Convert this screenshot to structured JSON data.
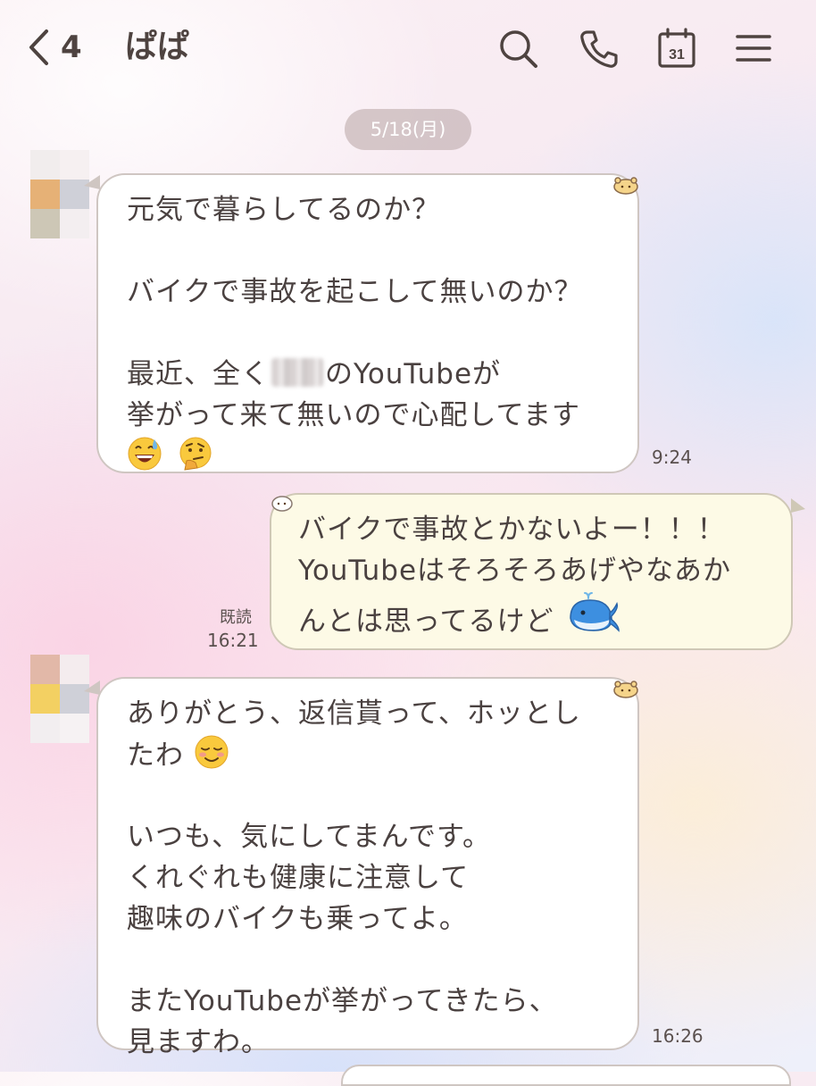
{
  "header": {
    "back_count": "4",
    "title": "ぱぱ",
    "calendar_day": "31"
  },
  "date_chip": "5/18(月)",
  "messages": [
    {
      "lines": [
        "元気で暮らしてるのか？",
        "",
        "バイクで事故を起こして無いのか？",
        "",
        "最近、全く",
        "のYouTubeが",
        "挙がって来て無いので心配してます"
      ],
      "time": "9:24"
    },
    {
      "lines": [
        "バイクで事故とかないよー！！！",
        "YouTubeはそろそろあげやなあか",
        "んとは思ってるけど"
      ],
      "read": "既読",
      "time": "16:21"
    },
    {
      "lines": [
        "ありがとう、返信貰って、ホッとし",
        "たわ",
        "",
        "いつも、気にしてまんです。",
        "くれぐれも健康に注意して",
        "趣味のバイクも乗ってよ。",
        "",
        "またYouTubeが挙がってきたら、",
        "見ますわ。"
      ],
      "time": "16:26"
    }
  ],
  "icons": {
    "back": "chevron-left-icon",
    "search": "search-icon",
    "call": "phone-icon",
    "calendar": "calendar-icon",
    "menu": "menu-icon",
    "emoji_sweat": "grinning-sweat-emoji",
    "emoji_thinking": "thinking-emoji",
    "emoji_whale": "whale-emoji",
    "emoji_smile": "smiling-blush-emoji"
  },
  "colors": {
    "incoming_bubble": "#ffffff",
    "outgoing_bubble": "#fdfae6",
    "date_chip": "#bfadad",
    "header_text": "#4e4340"
  }
}
